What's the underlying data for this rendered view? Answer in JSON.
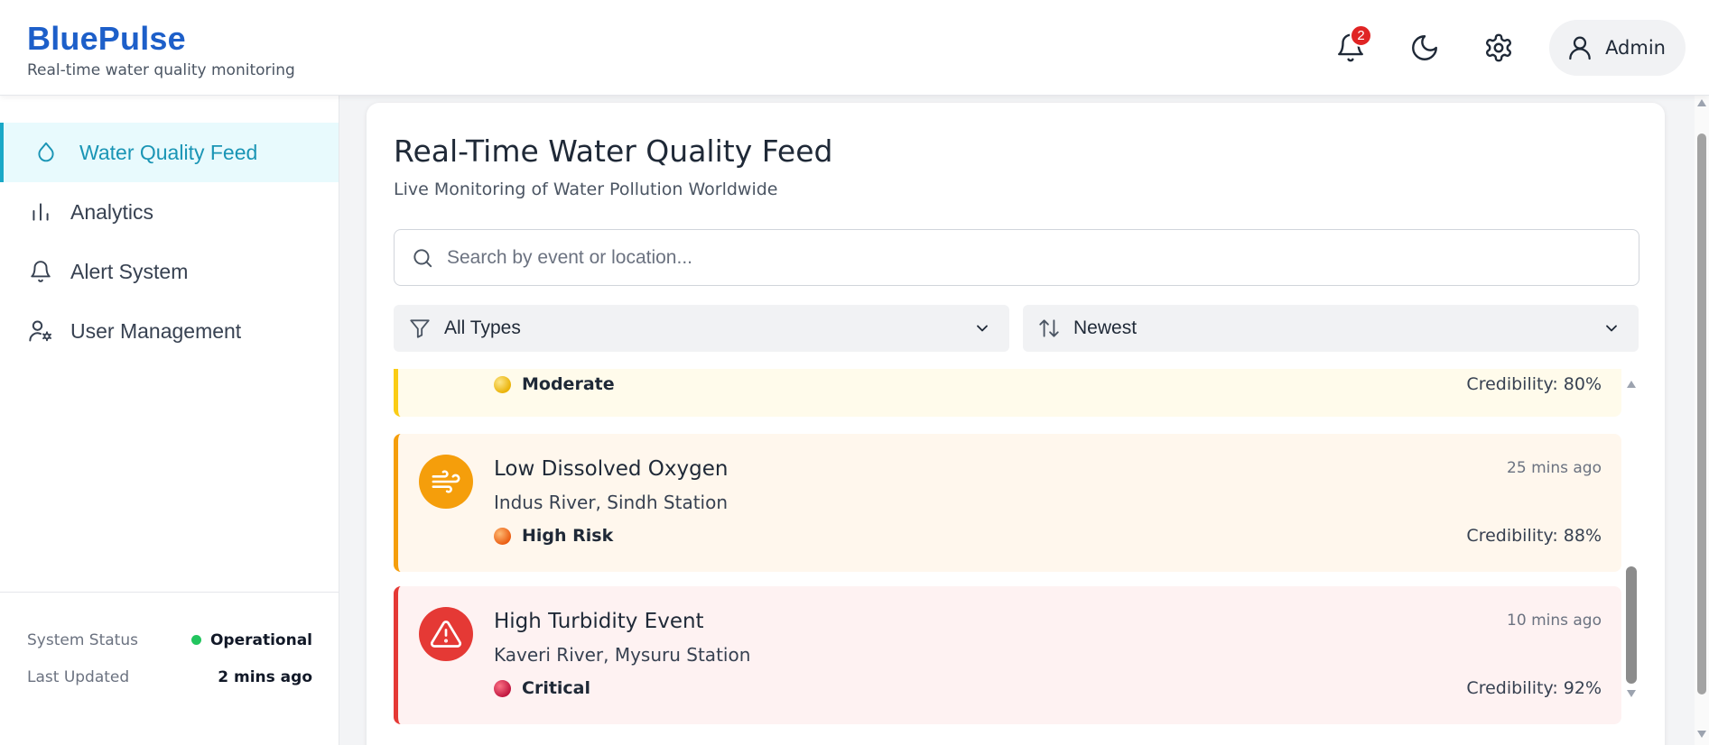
{
  "brand": {
    "title": "BluePulse",
    "subtitle": "Real-time water quality monitoring"
  },
  "header": {
    "notifications_count": "2",
    "user_label": "Admin"
  },
  "sidebar": {
    "items": [
      {
        "label": "Water Quality Feed",
        "icon": "droplet-icon",
        "active": true
      },
      {
        "label": "Analytics",
        "icon": "bar-chart-icon",
        "active": false
      },
      {
        "label": "Alert System",
        "icon": "bell-icon",
        "active": false
      },
      {
        "label": "User Management",
        "icon": "user-settings-icon",
        "active": false
      }
    ],
    "status": {
      "system_status_label": "System Status",
      "system_status_value": "Operational",
      "last_updated_label": "Last Updated",
      "last_updated_value": "2 mins ago"
    }
  },
  "main": {
    "title": "Real-Time Water Quality Feed",
    "subtitle": "Live Monitoring of Water Pollution Worldwide",
    "search": {
      "placeholder": "Search by event or location...",
      "value": ""
    },
    "filter_type": {
      "selected": "All Types"
    },
    "sort": {
      "selected": "Newest"
    },
    "feed": [
      {
        "severity": "Moderate",
        "credibility": "Credibility: 80%",
        "color": "#facc15",
        "bg": "#fffbeb",
        "partial": true
      },
      {
        "title": "Low Dissolved Oxygen",
        "location": "Indus River, Sindh Station",
        "severity": "High Risk",
        "time": "25 mins ago",
        "credibility": "Credibility: 88%",
        "icon": "wind-icon",
        "color": "#f59e0b",
        "bg": "#fff7ed"
      },
      {
        "title": "High Turbidity Event",
        "location": "Kaveri River, Mysuru Station",
        "severity": "Critical",
        "time": "10 mins ago",
        "credibility": "Credibility: 92%",
        "icon": "warning-triangle-icon",
        "color": "#e53935",
        "bg": "#fef2f2"
      }
    ]
  },
  "colors": {
    "brand": "#1d5fc9",
    "accent": "#1aa8c7",
    "moderate": "#facc15",
    "high_risk": "#f59e0b",
    "critical": "#e53935",
    "operational": "#22c55e"
  }
}
